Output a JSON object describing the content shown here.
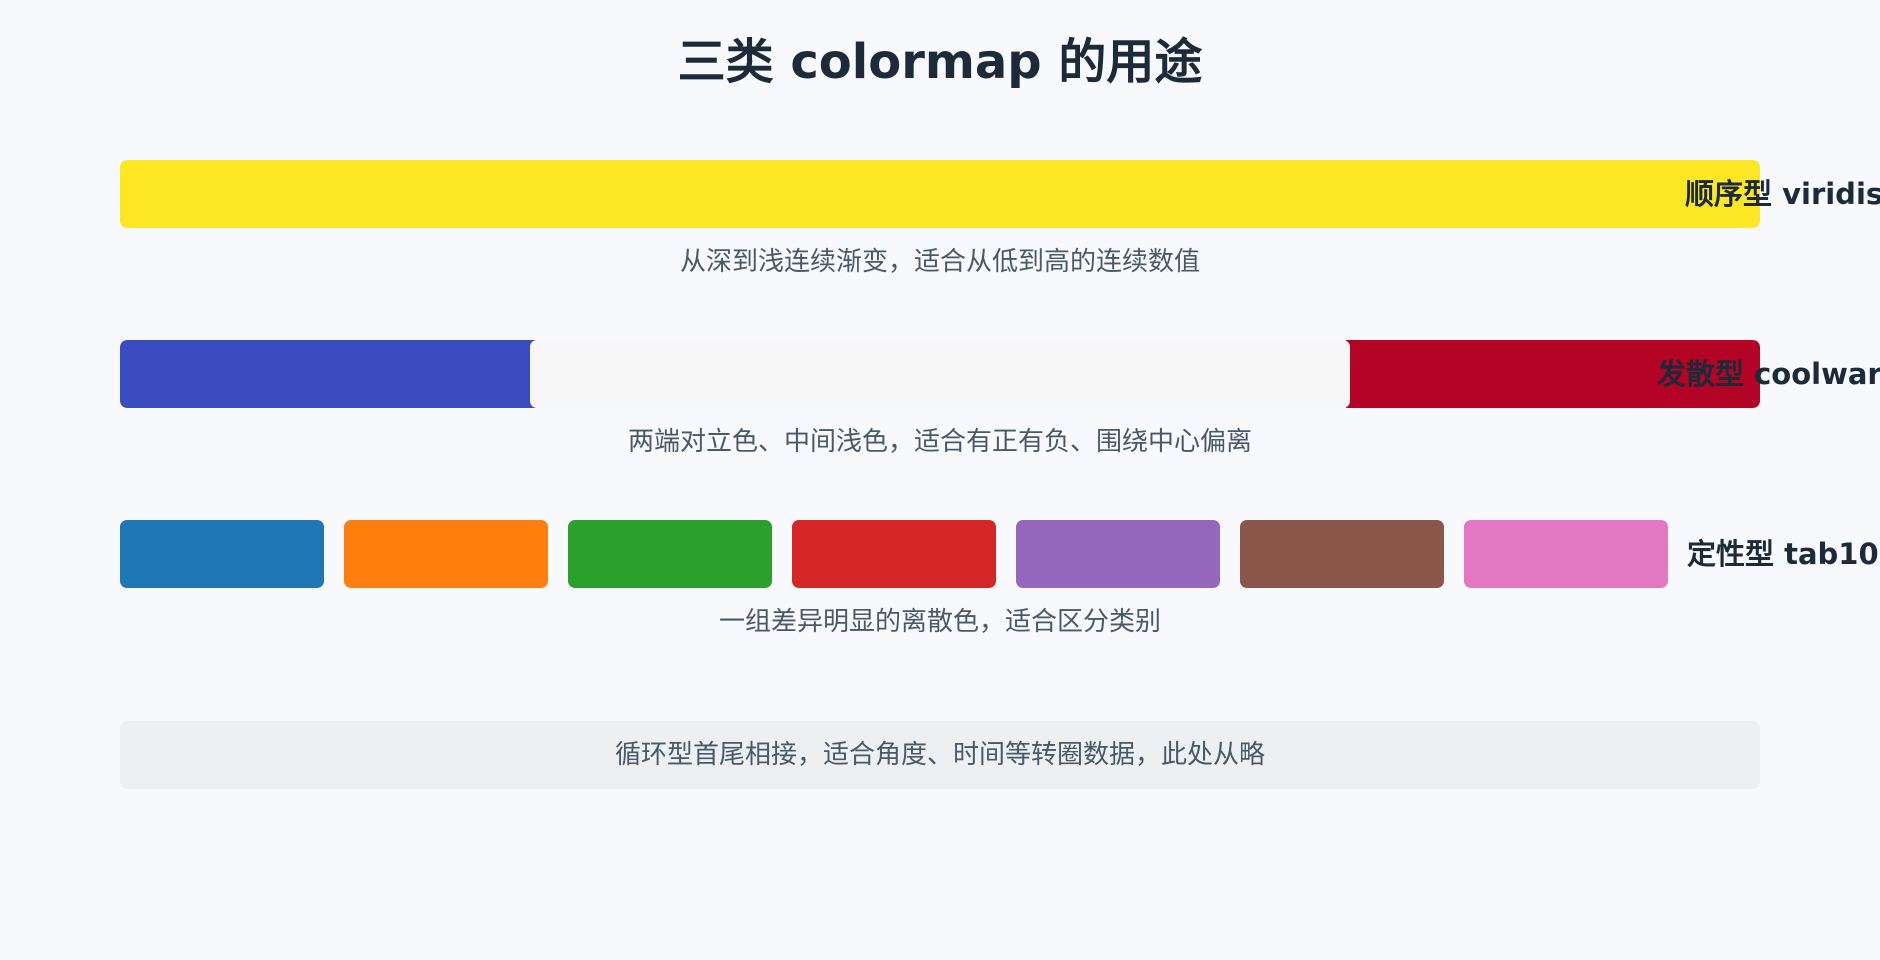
{
  "title": "三类 colormap 的用途",
  "rows": [
    {
      "label": "顺序型 viridis",
      "desc": "从深到浅连续渐变，适合从低到高的连续数值",
      "colors": [
        "#fde725"
      ]
    },
    {
      "label": "发散型 coolwarm",
      "desc": "两端对立色、中间浅色，适合有正有负、围绕中心偏离",
      "colors": [
        "#3b4cc0",
        "#f7f7f7",
        "#b40426"
      ]
    },
    {
      "label": "定性型 tab10",
      "desc": "一组差异明显的离散色，适合区分类别",
      "colors": [
        "#1f77b4",
        "#ff7f0e",
        "#2ca02c",
        "#d62728",
        "#9467bd",
        "#8c564b",
        "#e377c2"
      ]
    }
  ],
  "note": "循环型首尾相接，适合角度、时间等转圈数据，此处从略"
}
